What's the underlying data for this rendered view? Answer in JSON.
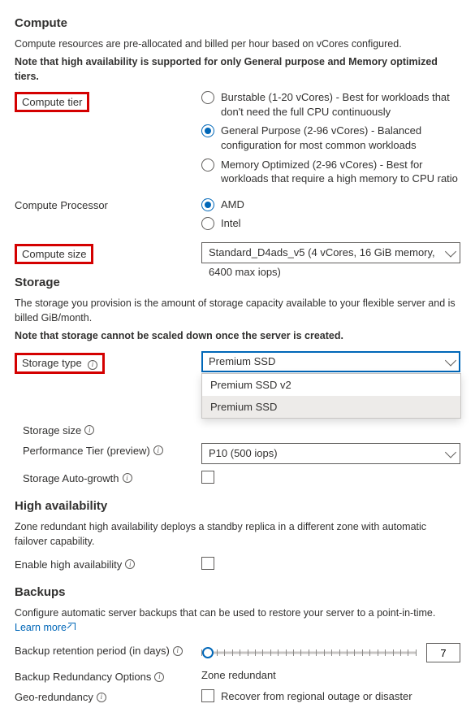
{
  "compute": {
    "heading": "Compute",
    "desc1": "Compute resources are pre-allocated and billed per hour based on vCores configured.",
    "desc2": "Note that high availability is supported for only General purpose and Memory optimized tiers.",
    "tier_label": "Compute tier",
    "tier_options": {
      "burstable": "Burstable (1-20 vCores) - Best for workloads that don't need the full CPU continuously",
      "general": "General Purpose (2-96 vCores) - Balanced configuration for most common workloads",
      "memory": "Memory Optimized (2-96 vCores) - Best for workloads that require a high memory to CPU ratio"
    },
    "processor_label": "Compute Processor",
    "processor_options": {
      "amd": "AMD",
      "intel": "Intel"
    },
    "size_label": "Compute size",
    "size_value": "Standard_D4ads_v5 (4 vCores, 16 GiB memory, 6400 max iops)"
  },
  "storage": {
    "heading": "Storage",
    "desc1": "The storage you provision is the amount of storage capacity available to your flexible server and is billed GiB/month.",
    "desc2": "Note that storage cannot be scaled down once the server is created.",
    "type_label": "Storage type",
    "type_value": "Premium SSD",
    "type_options": [
      "Premium SSD v2",
      "Premium SSD"
    ],
    "size_label": "Storage size",
    "perf_label": "Performance Tier (preview)",
    "perf_value": "P10 (500 iops)",
    "auto_label": "Storage Auto-growth"
  },
  "ha": {
    "heading": "High availability",
    "desc": "Zone redundant high availability deploys a standby replica in a different zone with automatic failover capability.",
    "enable_label": "Enable high availability"
  },
  "backups": {
    "heading": "Backups",
    "desc": "Configure automatic server backups that can be used to restore your server to a point-in-time.",
    "learn_more": "Learn more",
    "retention_label": "Backup retention period (in days)",
    "retention_value": "7",
    "redundancy_label": "Backup Redundancy Options",
    "redundancy_value": "Zone redundant",
    "geo_label": "Geo-redundancy",
    "geo_option": "Recover from regional outage or disaster"
  }
}
